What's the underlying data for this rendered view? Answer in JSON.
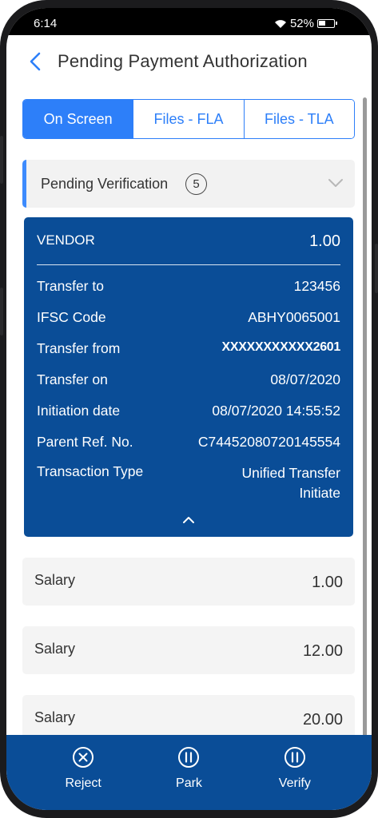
{
  "status_bar": {
    "time": "6:14",
    "battery": "52%"
  },
  "header": {
    "title": "Pending Payment Authorization"
  },
  "tabs": [
    {
      "label": "On Screen",
      "active": true
    },
    {
      "label": "Files - FLA",
      "active": false
    },
    {
      "label": "Files - TLA",
      "active": false
    }
  ],
  "pending": {
    "label": "Pending Verification",
    "count": "5"
  },
  "detail_card": {
    "vendor_label": "VENDOR",
    "vendor_amount": "1.00",
    "rows": [
      {
        "label": "Transfer to",
        "value": "123456"
      },
      {
        "label": "IFSC Code",
        "value": "ABHY0065001"
      },
      {
        "label": "Transfer from",
        "value": "XXXXXXXXXXX2601"
      },
      {
        "label": "Transfer on",
        "value": "08/07/2020"
      },
      {
        "label": "Initiation date",
        "value": "08/07/2020 14:55:52"
      },
      {
        "label": "Parent Ref. No.",
        "value": "C74452080720145554"
      },
      {
        "label": "Transaction Type",
        "value_line1": "Unified Transfer",
        "value_line2": "Initiate"
      }
    ]
  },
  "list": [
    {
      "label": "Salary",
      "amount": "1.00"
    },
    {
      "label": "Salary",
      "amount": "12.00"
    },
    {
      "label": "Salary",
      "amount": "20.00"
    }
  ],
  "actions": {
    "reject": "Reject",
    "park": "Park",
    "verify": "Verify"
  },
  "colors": {
    "primary": "#2d7ff9",
    "card": "#0a4d97"
  }
}
